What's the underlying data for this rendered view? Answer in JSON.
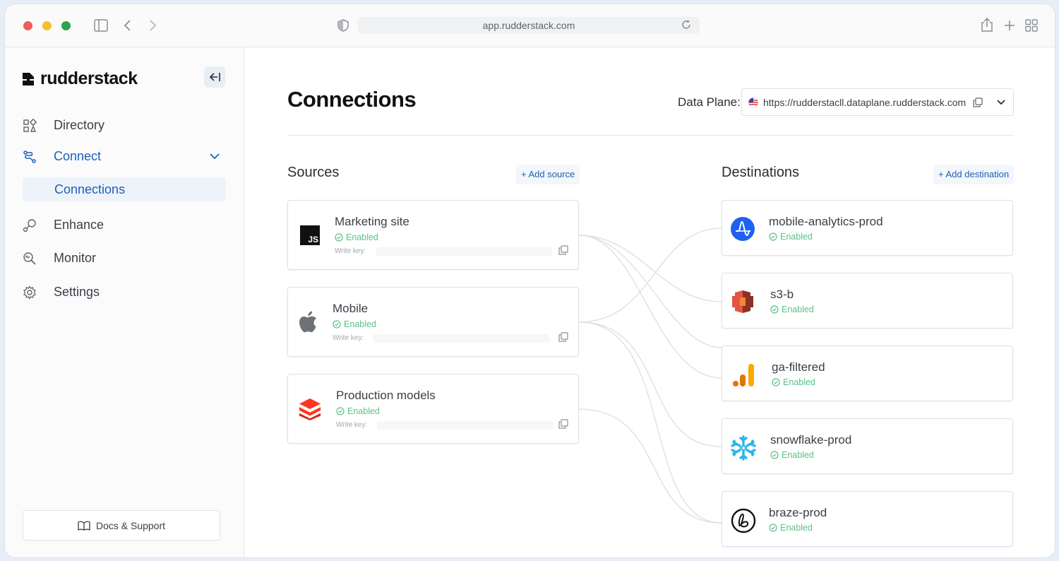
{
  "browser": {
    "url": "app.rudderstack.com"
  },
  "sidebar": {
    "logo": "rudderstack",
    "items": [
      {
        "label": "Directory"
      },
      {
        "label": "Connect"
      },
      {
        "label": "Enhance"
      },
      {
        "label": "Monitor"
      },
      {
        "label": "Settings"
      }
    ],
    "sub_item": "Connections",
    "docs": "Docs & Support"
  },
  "main": {
    "title": "Connections",
    "data_plane_label": "Data Plane:",
    "data_plane_url": "https://rudderstacll.dataplane.rudderstack.com",
    "sources_title": "Sources",
    "add_source": "+ Add source",
    "destinations_title": "Destinations",
    "add_destination": "+ Add destination",
    "write_key_label": "Write key:",
    "sources": [
      {
        "name": "Marketing site",
        "status": "Enabled",
        "icon": "javascript-icon"
      },
      {
        "name": "Mobile",
        "status": "Enabled",
        "icon": "apple-icon"
      },
      {
        "name": "Production models",
        "status": "Enabled",
        "icon": "databricks-icon"
      }
    ],
    "destinations": [
      {
        "name": "mobile-analytics-prod",
        "status": "Enabled",
        "icon": "amplitude-icon"
      },
      {
        "name": "s3-b",
        "status": "Enabled",
        "icon": "aws-s3-icon"
      },
      {
        "name": "ga-filtered",
        "status": "Enabled",
        "icon": "google-analytics-icon"
      },
      {
        "name": "snowflake-prod",
        "status": "Enabled",
        "icon": "snowflake-icon"
      },
      {
        "name": "braze-prod",
        "status": "Enabled",
        "icon": "braze-icon"
      }
    ]
  },
  "colors": {
    "accent": "#1c5fb8",
    "enabled": "#5dbf8a"
  }
}
